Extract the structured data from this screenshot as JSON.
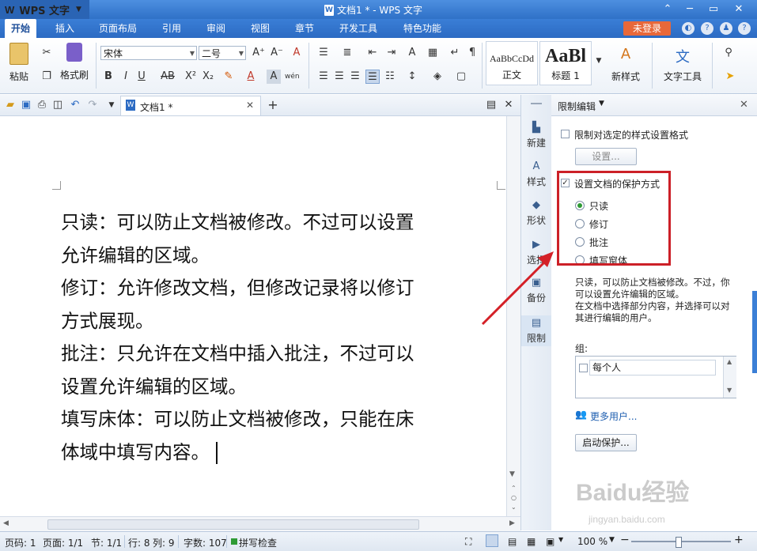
{
  "app": {
    "menu_label": "WPS 文字",
    "logo_text": "W",
    "title": "文档1 * - WPS 文字"
  },
  "tabs": [
    "开始",
    "插入",
    "页面布局",
    "引用",
    "审阅",
    "视图",
    "章节",
    "开发工具",
    "特色功能"
  ],
  "login_label": "未登录",
  "ribbon": {
    "paste": "粘贴",
    "format_painter": "格式刷",
    "font_name": "宋体",
    "font_size": "二号",
    "style_normal_sample": "AaBbCcDd",
    "style_normal": "正文",
    "style_h1_sample": "AaBl",
    "style_h1": "标题 1",
    "new_style": "新样式",
    "text_tools": "文字工具"
  },
  "doc_tab": "文档1 *",
  "document": {
    "lines": [
      "只读：可以防止文档被修改。不过可以设置",
      "允许编辑的区域。",
      "修订：允许修改文档，但修改记录将以修订",
      "方式展现。",
      "批注：只允许在文档中插入批注，不过可以",
      "设置允许编辑的区域。",
      "填写床体：可以防止文档被修改，只能在床",
      "体域中填写内容。"
    ]
  },
  "side_strip": [
    "新建",
    "样式",
    "形状",
    "选择",
    "备份",
    "限制"
  ],
  "pane": {
    "title": "限制编辑",
    "restrict_format": "限制对选定的样式设置格式",
    "settings_button": "设置...",
    "protect_label": "设置文档的保护方式",
    "options": [
      "只读",
      "修订",
      "批注",
      "填写窗体"
    ],
    "selected_option": "只读",
    "description": [
      "只读，可以防止文档被修改。不过，你",
      "可以设置允许编辑的区域。",
      "在文档中选择部分内容，并选择可以对",
      "其进行编辑的用户。"
    ],
    "group_label": "组:",
    "group_item": "每个人",
    "more_users": "更多用户...",
    "start_protect": "启动保护..."
  },
  "status": {
    "page_code": "页码: 1",
    "page": "页面: 1/1",
    "section": "节: 1/1",
    "line": "行: 8",
    "col": "列: 9",
    "words": "字数: 107",
    "spellcheck": "拼写检查",
    "zoom": "100 %"
  },
  "watermark": {
    "main": "Baidu经验",
    "sub": "jingyan.baidu.com"
  },
  "colors": {
    "titlebar": "#2f71c7",
    "login": "#e8683a",
    "highlight_box": "#cc2027",
    "radio_selected": "#2e9a35"
  }
}
